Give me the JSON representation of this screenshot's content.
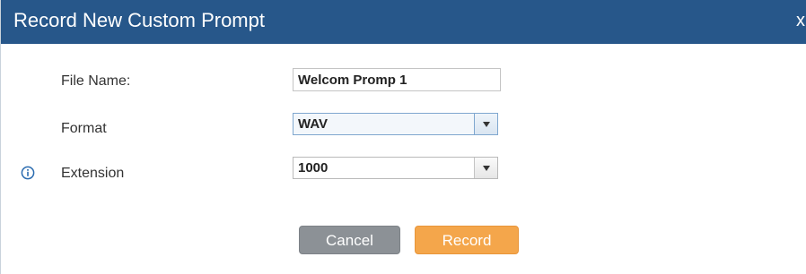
{
  "dialog": {
    "title": "Record New Custom Prompt",
    "close_label": "x"
  },
  "form": {
    "file_name": {
      "label": "File Name:",
      "value": "Welcom Promp 1"
    },
    "format": {
      "label": "Format",
      "selected": "WAV"
    },
    "extension": {
      "label": "Extension",
      "selected": "1000",
      "info_icon": "info-circle-icon"
    }
  },
  "buttons": {
    "cancel_label": "Cancel",
    "record_label": "Record"
  },
  "colors": {
    "titlebar": "#27578a",
    "record_button": "#f4a64b",
    "cancel_button": "#8c9196",
    "info_icon": "#2b6cb0"
  }
}
